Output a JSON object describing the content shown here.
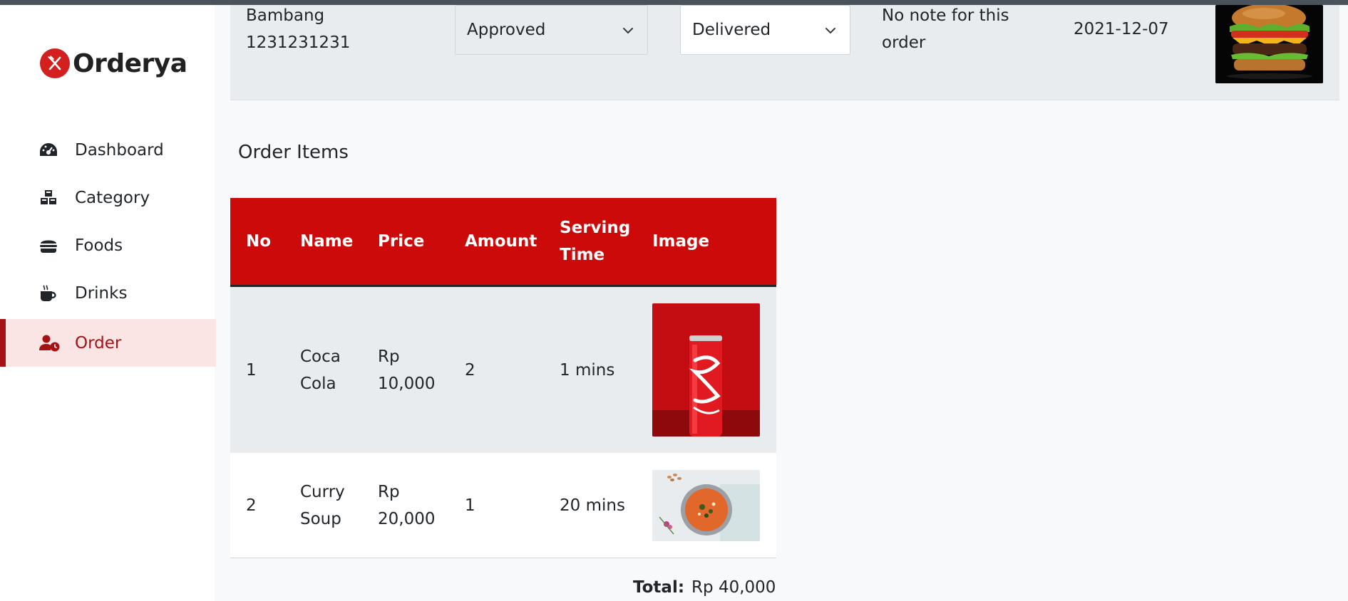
{
  "brand": {
    "name": "Orderya",
    "accent": "#cd0a0a"
  },
  "sidebar": {
    "items": [
      {
        "label": "Dashboard",
        "icon": "dashboard-gauge-icon"
      },
      {
        "label": "Category",
        "icon": "cubes-icon"
      },
      {
        "label": "Foods",
        "icon": "burger-icon"
      },
      {
        "label": "Drinks",
        "icon": "coffee-mug-icon"
      },
      {
        "label": "Order",
        "icon": "user-clock-icon",
        "active": true
      }
    ]
  },
  "order": {
    "customer_name": "Bambang",
    "customer_phone": "1231231231",
    "payment_status": "Approved",
    "delivery_status": "Delivered",
    "note_line1": "No note for this",
    "note_line2": "order",
    "date": "2021-12-07",
    "image_icon": "burger-photo"
  },
  "items_section": {
    "title": "Order Items",
    "headers": {
      "no": "No",
      "name": "Name",
      "price": "Price",
      "amount": "Amount",
      "serving_line1": "Serving",
      "serving_line2": "Time",
      "image": "Image"
    },
    "rows": [
      {
        "no": "1",
        "name_line1": "Coca",
        "name_line2": "Cola",
        "price_line1": "Rp",
        "price_line2": "10,000",
        "amount": "2",
        "serving": "1 mins",
        "image_icon": "coca-cola-photo"
      },
      {
        "no": "2",
        "name_line1": "Curry",
        "name_line2": "Soup",
        "price_line1": "Rp",
        "price_line2": "20,000",
        "amount": "1",
        "serving": "20 mins",
        "image_icon": "curry-soup-photo"
      }
    ]
  },
  "total": {
    "label": "Total:",
    "value": "Rp 40,000"
  }
}
